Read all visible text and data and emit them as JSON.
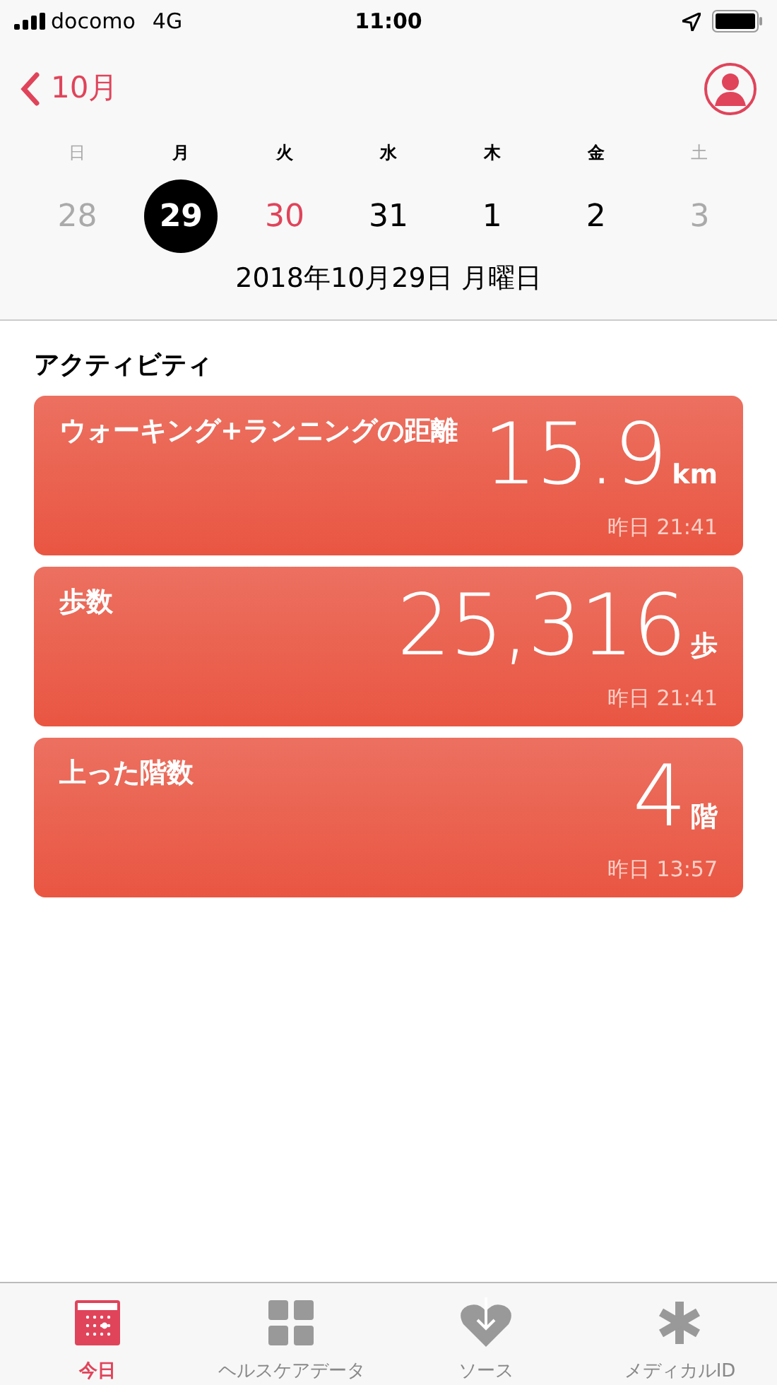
{
  "status_bar": {
    "carrier": "docomo",
    "network": "4G",
    "time": "11:00"
  },
  "nav": {
    "back_label": "10月"
  },
  "weekdays": [
    {
      "label": "日",
      "muted": true
    },
    {
      "label": "月",
      "muted": false
    },
    {
      "label": "火",
      "muted": false
    },
    {
      "label": "水",
      "muted": false
    },
    {
      "label": "木",
      "muted": false
    },
    {
      "label": "金",
      "muted": false
    },
    {
      "label": "土",
      "muted": true
    }
  ],
  "days": [
    {
      "label": "28",
      "muted": true,
      "today": false,
      "selected": false
    },
    {
      "label": "29",
      "muted": false,
      "today": false,
      "selected": true
    },
    {
      "label": "30",
      "muted": false,
      "today": true,
      "selected": false
    },
    {
      "label": "31",
      "muted": false,
      "today": false,
      "selected": false
    },
    {
      "label": "1",
      "muted": false,
      "today": false,
      "selected": false
    },
    {
      "label": "2",
      "muted": false,
      "today": false,
      "selected": false
    },
    {
      "label": "3",
      "muted": true,
      "today": false,
      "selected": false
    }
  ],
  "date_label": "2018年10月29日 月曜日",
  "section_title": "アクティビティ",
  "cards": [
    {
      "title": "ウォーキング+ランニングの距離",
      "value": "15.9",
      "unit": "km",
      "time": "昨日 21:41"
    },
    {
      "title": "歩数",
      "value": "25,316",
      "unit": "歩",
      "time": "昨日 21:41"
    },
    {
      "title": "上った階数",
      "value": "4",
      "unit": "階",
      "time": "昨日 13:57"
    }
  ],
  "tabs": [
    {
      "label": "今日",
      "kind": "today",
      "selected": true
    },
    {
      "label": "ヘルスケアデータ",
      "kind": "grid",
      "selected": false
    },
    {
      "label": "ソース",
      "kind": "heart",
      "selected": false
    },
    {
      "label": "メディカルID",
      "kind": "medical",
      "selected": false
    }
  ]
}
